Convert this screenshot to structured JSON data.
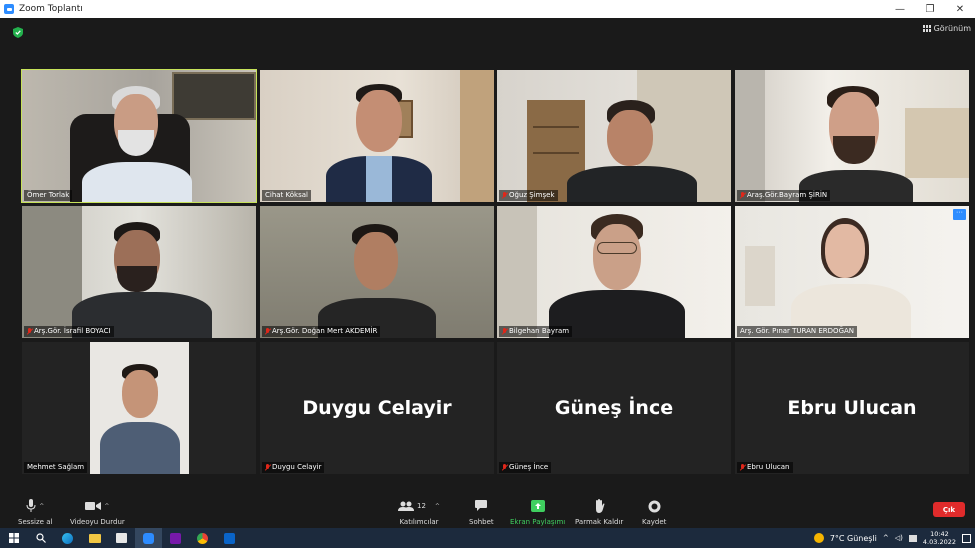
{
  "window": {
    "title": "Zoom Toplantı",
    "minimize": "—",
    "restore": "❐",
    "close": "✕"
  },
  "header": {
    "view_label": "Görünüm"
  },
  "participants": [
    {
      "name": "Ömer Torlak",
      "muted": false,
      "active_speaker": true
    },
    {
      "name": "Cihat Köksal",
      "muted": false
    },
    {
      "name": "Oğuz Şimşek",
      "muted": true
    },
    {
      "name": "Araş.Gör.Bayram ŞİRİN",
      "muted": true
    },
    {
      "name": "Arş.Gör. İsrafil BOYACI",
      "muted": true
    },
    {
      "name": "Arş.Gör. Doğan Mert AKDEMİR",
      "muted": true
    },
    {
      "name": "Bilgehan Bayram",
      "muted": true
    },
    {
      "name": "Arş. Gör. Pınar TURAN ERDOĞAN",
      "muted": false,
      "more_button": "···"
    },
    {
      "name": "Mehmet Sağlam",
      "muted": false
    },
    {
      "name": "Duygu Celayir",
      "muted": true,
      "video_off": true
    },
    {
      "name": "Güneş İnce",
      "muted": true,
      "video_off": true
    },
    {
      "name": "Ebru Ulucan",
      "muted": true,
      "video_off": true
    }
  ],
  "toolbar": {
    "mute": "Sessize al",
    "video": "Videoyu Durdur",
    "participants": "Katılımcılar",
    "participants_count": "12",
    "chat": "Sohbet",
    "share": "Ekran Paylaşımı",
    "raise_hand": "Parmak Kaldır",
    "record": "Kaydet",
    "leave": "Çık"
  },
  "taskbar": {
    "weather": "7°C  Güneşli",
    "time": "10:42",
    "date": "4.03.2022"
  },
  "colors": {
    "accent": "#2d8cff",
    "active_border": "#c7e35a",
    "leave": "#e02b2b",
    "share_green": "#3fcf5f"
  }
}
